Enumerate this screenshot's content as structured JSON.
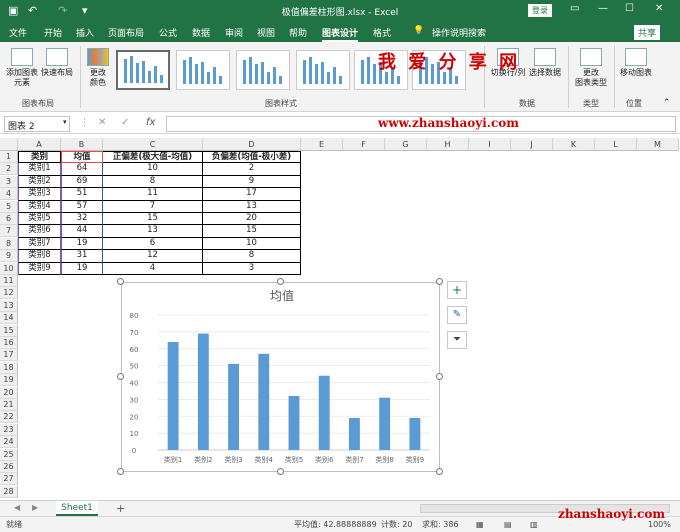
{
  "titlebar": {
    "title": "极值偏差柱形图.xlsx - Excel",
    "login": "登录"
  },
  "tabs": [
    "文件",
    "开始",
    "插入",
    "页面布局",
    "公式",
    "数据",
    "审阅",
    "视图",
    "帮助",
    "图表设计",
    "格式"
  ],
  "active_tab": "图表设计",
  "tell_me": "操作说明搜索",
  "share": "共享",
  "ribbon": {
    "add_element": "添加图表\n元素",
    "quick_layout": "快速布局",
    "change_color": "更改\n颜色",
    "group_layout": "图表布局",
    "group_styles": "图表样式",
    "switch_rowcol": "切换行/列",
    "select_data": "选择数据",
    "group_data": "数据",
    "change_type": "更改\n图表类型",
    "group_type": "类型",
    "move_chart": "移动图表",
    "group_location": "位置"
  },
  "watermark": {
    "text": "我 爱 分 享 网",
    "url": "www.zhanshaoyi.com",
    "url2": "zhanshaoyi.com"
  },
  "formula_bar": {
    "name_box": "图表 2",
    "fx": "fx",
    "value": ""
  },
  "columns": [
    "A",
    "B",
    "C",
    "D",
    "E",
    "F",
    "G",
    "H",
    "I",
    "J",
    "K",
    "L",
    "M"
  ],
  "rows": [
    "1",
    "2",
    "3",
    "4",
    "5",
    "6",
    "7",
    "8",
    "9",
    "10",
    "11",
    "12",
    "13",
    "14",
    "15",
    "16",
    "17",
    "18",
    "19",
    "20",
    "21",
    "22",
    "23",
    "24",
    "25",
    "26",
    "27",
    "28"
  ],
  "table": {
    "headers": [
      "类别",
      "均值",
      "正偏差(极大值-均值)",
      "负偏差(均值-极小差)"
    ],
    "rows": [
      [
        "类别1",
        "64",
        "10",
        "2"
      ],
      [
        "类别2",
        "69",
        "8",
        "9"
      ],
      [
        "类别3",
        "51",
        "11",
        "17"
      ],
      [
        "类别4",
        "57",
        "7",
        "13"
      ],
      [
        "类别5",
        "32",
        "15",
        "20"
      ],
      [
        "类别6",
        "44",
        "13",
        "15"
      ],
      [
        "类别7",
        "19",
        "6",
        "10"
      ],
      [
        "类别8",
        "31",
        "12",
        "8"
      ],
      [
        "类别9",
        "19",
        "4",
        "3"
      ]
    ]
  },
  "chart_data": {
    "type": "bar",
    "title": "均值",
    "categories": [
      "类别1",
      "类别2",
      "类别3",
      "类别4",
      "类别5",
      "类别6",
      "类别7",
      "类别8",
      "类别9"
    ],
    "values": [
      64,
      69,
      51,
      57,
      32,
      44,
      19,
      31,
      19
    ],
    "ylim": [
      0,
      80
    ],
    "yticks": [
      "0",
      "10",
      "20",
      "30",
      "40",
      "50",
      "60",
      "70",
      "80"
    ],
    "bar_color": "#5b9bd5",
    "grid": true
  },
  "sheet": {
    "tab": "Sheet1",
    "add": "+"
  },
  "status": {
    "ready": "就绪",
    "average": "平均值: 42.88888889",
    "count": "计数: 20",
    "sum": "求和: 386",
    "zoom": "100%"
  }
}
